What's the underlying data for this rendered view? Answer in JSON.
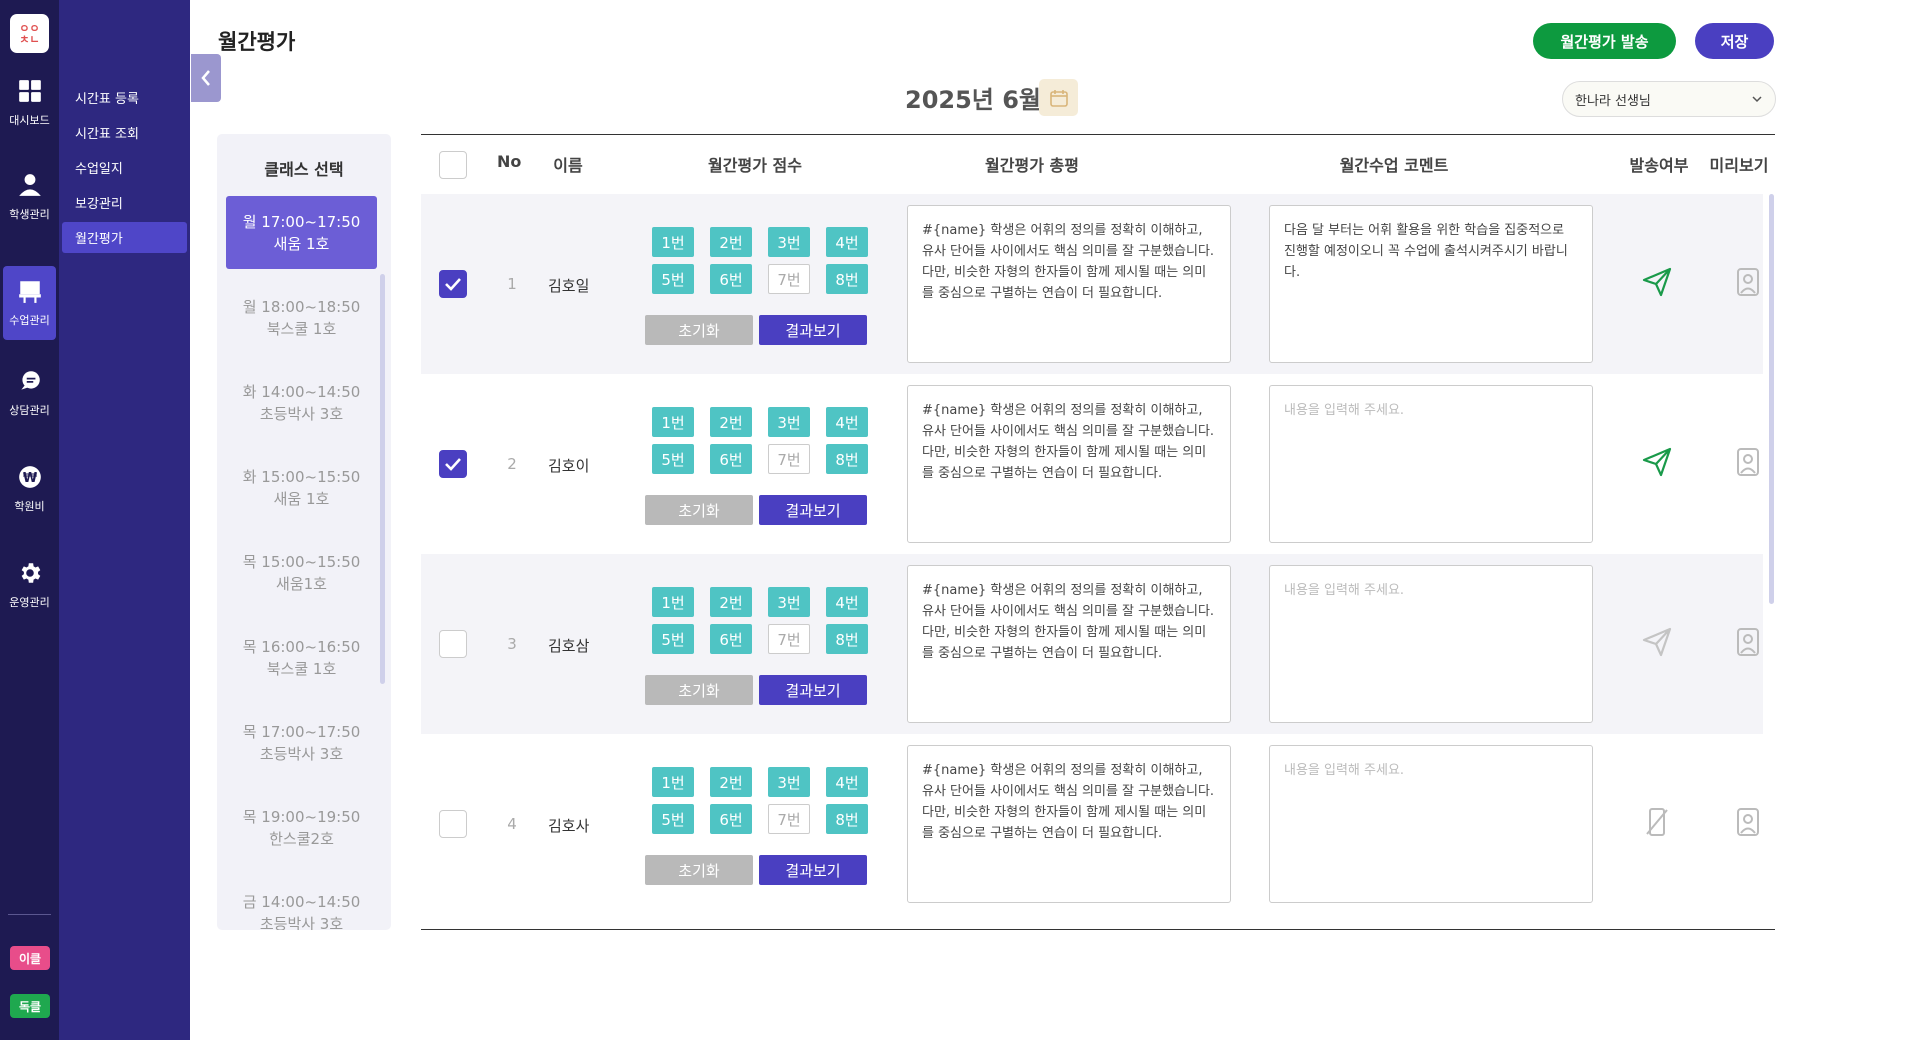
{
  "app": {
    "logo_text": "ㅇㅇ ㅊㄴ"
  },
  "rail": {
    "items": [
      {
        "label": "대시보드",
        "icon": "dashboard-icon"
      },
      {
        "label": "학생관리",
        "icon": "student-icon"
      },
      {
        "label": "수업관리",
        "icon": "class-icon"
      },
      {
        "label": "상담관리",
        "icon": "chat-icon"
      },
      {
        "label": "학원비",
        "icon": "won-icon"
      },
      {
        "label": "운영관리",
        "icon": "gear-icon"
      }
    ],
    "badges": [
      {
        "label": "이클",
        "color": "#e84d8a"
      },
      {
        "label": "독클",
        "color": "#1fa84f"
      }
    ]
  },
  "submenu": {
    "items": [
      "시간표 등록",
      "시간표 조회",
      "수업일지",
      "보강관리",
      "월간평가"
    ],
    "active": "월간평가"
  },
  "header": {
    "title": "월간평가",
    "send_button": "월간평가 발송",
    "save_button": "저장",
    "month": "2025년 6월",
    "teacher": "한나라 선생님"
  },
  "class_panel": {
    "title": "클래스 선택",
    "items": [
      {
        "time": "월 17:00~17:50",
        "name": "새움 1호"
      },
      {
        "time": "월 18:00~18:50",
        "name": "북스쿨 1호"
      },
      {
        "time": "화 14:00~14:50",
        "name": "초등박사 3호"
      },
      {
        "time": "화 15:00~15:50",
        "name": "새움 1호"
      },
      {
        "time": "목 15:00~15:50",
        "name": "새움1호"
      },
      {
        "time": "목 16:00~16:50",
        "name": "북스쿨 1호"
      },
      {
        "time": "목 17:00~17:50",
        "name": "초등박사 3호"
      },
      {
        "time": "목 19:00~19:50",
        "name": "한스쿨2호"
      },
      {
        "time": "금 14:00~14:50",
        "name": "초등박사 3호"
      }
    ]
  },
  "table": {
    "headers": {
      "no": "No",
      "name": "이름",
      "score": "월간평가 점수",
      "review": "월간평가 총평",
      "comment": "월간수업 코멘트",
      "sent": "발송여부",
      "preview": "미리보기"
    },
    "score_labels": [
      "1번",
      "2번",
      "3번",
      "4번",
      "5번",
      "6번",
      "7번",
      "8번"
    ],
    "reset_label": "초기화",
    "result_label": "결과보기",
    "comment_placeholder": "내용을 입력해 주세요.",
    "rows": [
      {
        "checked": true,
        "no": "1",
        "name": "김호일",
        "review": "#{name} 학생은 어휘의 정의를 정확히 이해하고, 유사 단어들 사이에서도 핵심 의미를 잘 구분했습니다. 다만, 비슷한 자형의 한자들이 함께 제시될 때는 의미를 중심으로 구별하는 연습이 더 필요합니다.",
        "comment": "다음 달 부터는 어휘 활용을 위한 학습을 집중적으로 진행할 예정이오니 꼭 수업에 출석시켜주시기 바랍니다.",
        "sent_state": "sent"
      },
      {
        "checked": true,
        "no": "2",
        "name": "김호이",
        "review": "#{name} 학생은 어휘의 정의를 정확히 이해하고, 유사 단어들 사이에서도 핵심 의미를 잘 구분했습니다. 다만, 비슷한 자형의 한자들이 함께 제시될 때는 의미를 중심으로 구별하는 연습이 더 필요합니다.",
        "comment": "",
        "sent_state": "sent"
      },
      {
        "checked": false,
        "no": "3",
        "name": "김호삼",
        "review": "#{name} 학생은 어휘의 정의를 정확히 이해하고, 유사 단어들 사이에서도 핵심 의미를 잘 구분했습니다. 다만, 비슷한 자형의 한자들이 함께 제시될 때는 의미를 중심으로 구별하는 연습이 더 필요합니다.",
        "comment": "",
        "sent_state": "not-sent"
      },
      {
        "checked": false,
        "no": "4",
        "name": "김호사",
        "review": "#{name} 학생은 어휘의 정의를 정확히 이해하고, 유사 단어들 사이에서도 핵심 의미를 잘 구분했습니다. 다만, 비슷한 자형의 한자들이 함께 제시될 때는 의미를 중심으로 구별하는 연습이 더 필요합니다.",
        "comment": "",
        "sent_state": "no-phone"
      }
    ]
  },
  "colors": {
    "rail_bg": "#1e1a52",
    "submenu_bg": "#2e2880",
    "accent": "#4a3fc1",
    "send_green": "#0d9a3f",
    "score_teal": "#4fc4c4",
    "sent_icon": "#1a9a4a"
  }
}
